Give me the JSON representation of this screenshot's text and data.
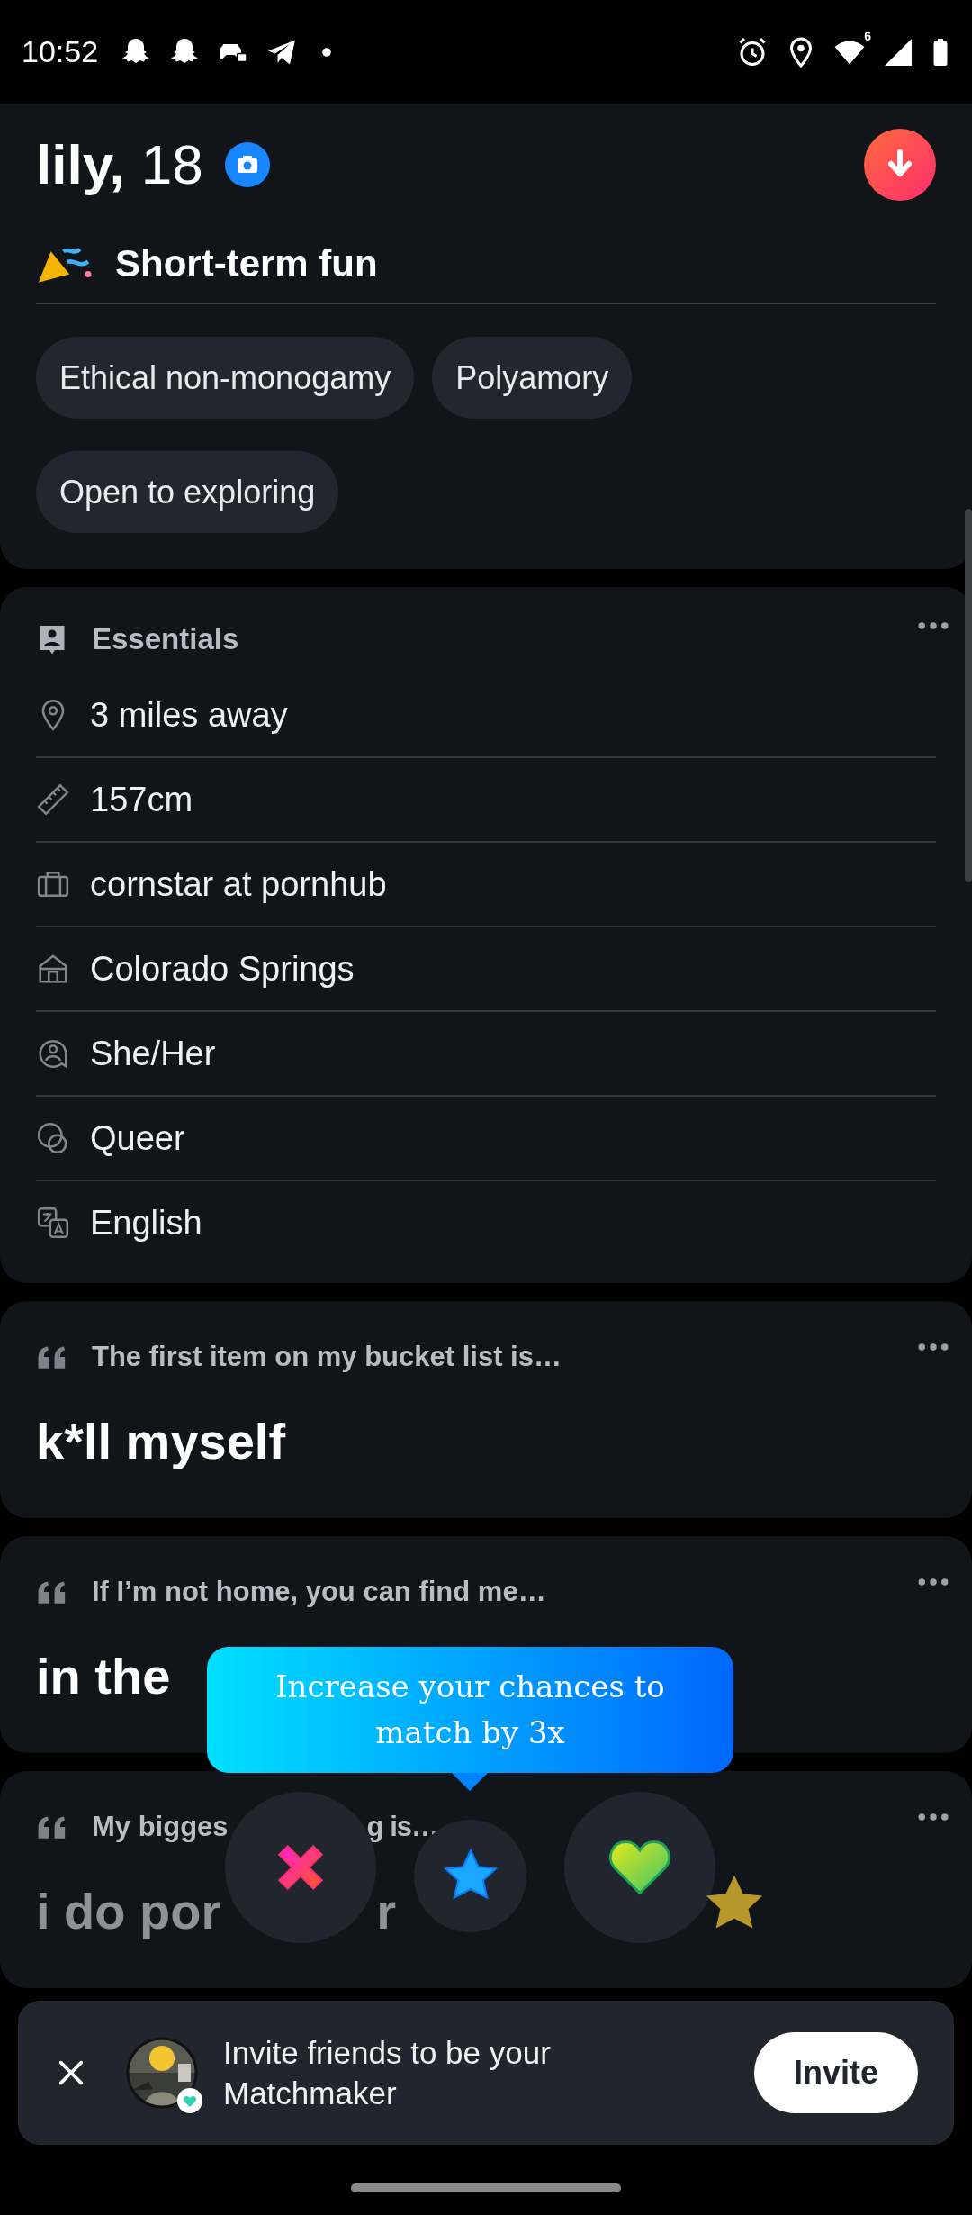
{
  "status_bar": {
    "time": "10:52",
    "wifi_badge": "6"
  },
  "header": {
    "name": "lily,",
    "age": "18"
  },
  "relationship_card": {
    "heading": "Short-term fun",
    "tags": [
      "Ethical non-monogamy",
      "Polyamory",
      "Open to exploring"
    ]
  },
  "essentials": {
    "title": "Essentials",
    "rows": [
      {
        "kind": "location",
        "text": "3 miles away"
      },
      {
        "kind": "height",
        "text": "157cm"
      },
      {
        "kind": "work",
        "text": "cornstar at pornhub"
      },
      {
        "kind": "home",
        "text": "Colorado Springs"
      },
      {
        "kind": "pronouns",
        "text": "She/Her"
      },
      {
        "kind": "orientation",
        "text": "Queer"
      },
      {
        "kind": "language",
        "text": "English"
      }
    ]
  },
  "prompts": [
    {
      "label_parts": [
        "The first item on my bucket list is…"
      ],
      "answer_parts": [
        "k*ll myself"
      ],
      "dimmed": false
    },
    {
      "label_parts": [
        "If I’m not home, you can find me…"
      ],
      "answer_parts": [
        "in the"
      ],
      "dimmed": false
    },
    {
      "label_parts": [
        "My bigges",
        "g is…"
      ],
      "answer_parts": [
        "i do por",
        "r"
      ],
      "dimmed": true
    }
  ],
  "tooltip": {
    "text": "Increase your chances to match by 3x"
  },
  "actions": [
    {
      "kind": "nope"
    },
    {
      "kind": "super_like"
    },
    {
      "kind": "like"
    }
  ],
  "banner": {
    "text": "Invite friends to be your Matchmaker",
    "button": "Invite"
  }
}
